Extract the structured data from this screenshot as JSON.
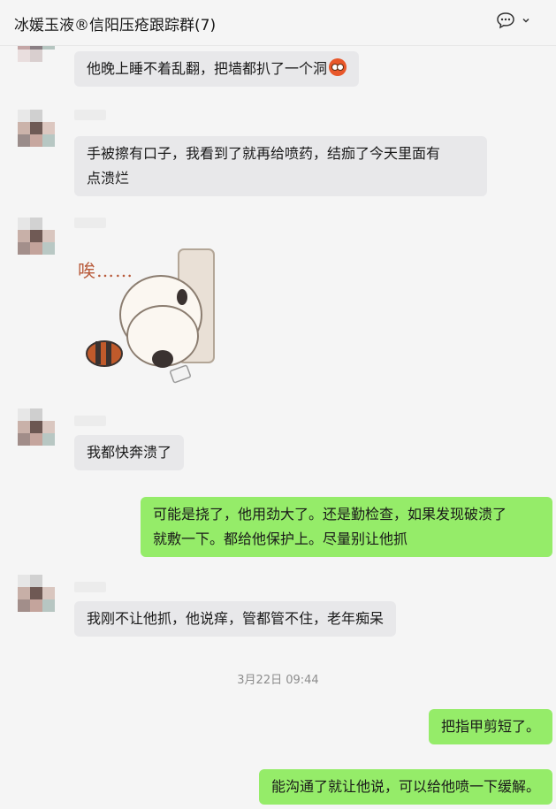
{
  "header": {
    "title": "冰媛玉液®信阳压疮跟踪群(7)",
    "icons": [
      "chat-bubble-icon",
      "chevron-down-icon"
    ]
  },
  "messages": [
    {
      "side": "in",
      "text": "他晚上睡不着乱翻，把墙都扒了一个洞",
      "emoji": "face-emoji"
    },
    {
      "side": "in",
      "text_line1": "手被擦有口子，我看到了就再给喷药，结痂了今天里面有",
      "text_line2": "点溃烂"
    },
    {
      "side": "in",
      "sticker": "panda-sigh-sticker",
      "sticker_text": "唉……"
    },
    {
      "side": "in",
      "text": "我都快奔溃了"
    },
    {
      "side": "out",
      "text_line1": "可能是挠了，他用劲大了。还是勤检查，如果发现破溃了",
      "text_line2": "就敷一下。都给他保护上。尽量别让他抓"
    },
    {
      "side": "in",
      "text": "我刚不让他抓，他说痒，管都管不住，老年痴呆"
    },
    {
      "side": "out",
      "text": "把指甲剪短了。"
    },
    {
      "side": "out",
      "text": "能沟通了就让他说，可以给他喷一下缓解。"
    }
  ],
  "timestamp": "3月22日 09:44",
  "colors": {
    "outgoing_bubble": "#95ec69",
    "incoming_bubble": "#e8e8ea",
    "background": "#f5f5f5"
  }
}
